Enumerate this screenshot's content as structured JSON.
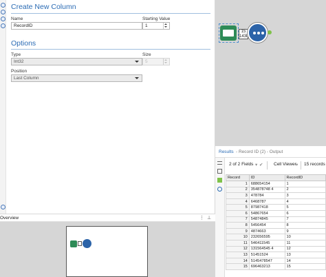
{
  "config": {
    "create_section": "Create New Column",
    "name_label": "Name",
    "name_value": "RecordID",
    "start_label": "Starting Value",
    "start_value": "1",
    "options_section": "Options",
    "type_label": "Type",
    "type_value": "Int32",
    "size_label": "Size",
    "size_value": "5",
    "position_label": "Position",
    "position_value": "Last Column"
  },
  "canvas": {
    "badge_count": "15",
    "badge_size": "143b"
  },
  "overview": {
    "title": "Overview",
    "pin": "⊥"
  },
  "results": {
    "title": "Results",
    "subtitle": "- Record ID (2) - Output",
    "fields_label": "2 of 2 Fields",
    "viewer_label": "Cell Viewer",
    "records_label": "15 records",
    "columns": [
      "Record",
      "ID",
      "RecordID"
    ],
    "rows": [
      [
        "1",
        "688654154",
        "1"
      ],
      [
        "2",
        "354878748 4",
        "2"
      ],
      [
        "3",
        "478784",
        "3"
      ],
      [
        "4",
        "6468787",
        "4"
      ],
      [
        "5",
        "87987418",
        "5"
      ],
      [
        "6",
        "54867654",
        "6"
      ],
      [
        "7",
        "54874845",
        "7"
      ],
      [
        "8",
        "5456454",
        "8"
      ],
      [
        "9",
        "4874663",
        "9"
      ],
      [
        "10",
        "232656595",
        "10"
      ],
      [
        "11",
        "546411545",
        "11"
      ],
      [
        "12",
        "131564545 4",
        "12"
      ],
      [
        "13",
        "51451524",
        "13"
      ],
      [
        "14",
        "5145478547",
        "14"
      ],
      [
        "15",
        "696463213",
        "15"
      ]
    ]
  },
  "colors": {
    "accent": "#2a6bb4",
    "canvas_bg": "#d6d6d6",
    "input_tool": "#2e8b57",
    "browse_tool": "#2c63a8",
    "anchor": "#7fc24a"
  },
  "icons": {
    "type_dropdown": "chevron-down-icon",
    "position_dropdown": "chevron-down-icon",
    "input_tool": "book-icon",
    "browse_tool": "binoculars-icon",
    "pin": "pin-icon"
  }
}
